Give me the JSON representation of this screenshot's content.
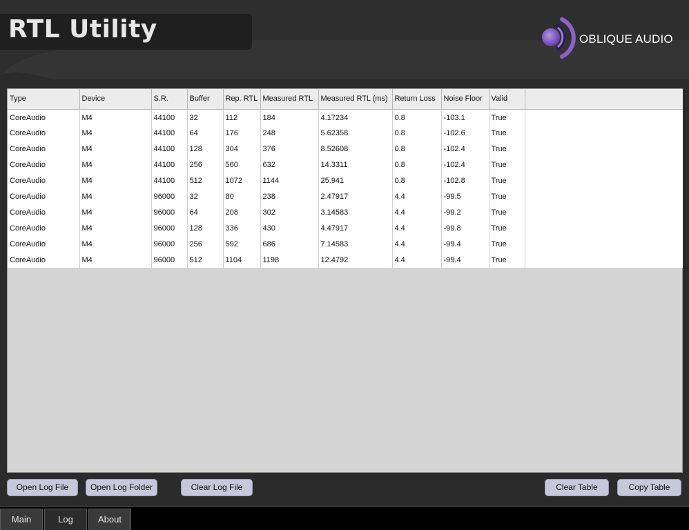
{
  "header": {
    "title": "RTL Utility",
    "brand": "OBLIQUE AUDIO",
    "logo_icon": "oblique-audio-logo-icon",
    "accent_color": "#8a62c8"
  },
  "table": {
    "columns": [
      "Type",
      "Device",
      "S.R.",
      "Buffer",
      "Rep. RTL",
      "Measured RTL",
      "Measured RTL (ms)",
      "Return Loss",
      "Noise Floor",
      "Valid"
    ],
    "rows": [
      [
        "CoreAudio",
        "M4",
        "44100",
        "32",
        "112",
        "184",
        "4.17234",
        "0.8",
        "-103.1",
        "True"
      ],
      [
        "CoreAudio",
        "M4",
        "44100",
        "64",
        "176",
        "248",
        "5.62358",
        "0.8",
        "-102.6",
        "True"
      ],
      [
        "CoreAudio",
        "M4",
        "44100",
        "128",
        "304",
        "376",
        "8.52608",
        "0.8",
        "-102.4",
        "True"
      ],
      [
        "CoreAudio",
        "M4",
        "44100",
        "256",
        "560",
        "632",
        "14.3311",
        "0.8",
        "-102.4",
        "True"
      ],
      [
        "CoreAudio",
        "M4",
        "44100",
        "512",
        "1072",
        "1144",
        "25.941",
        "0.8",
        "-102.8",
        "True"
      ],
      [
        "CoreAudio",
        "M4",
        "96000",
        "32",
        "80",
        "238",
        "2.47917",
        "4.4",
        "-99.5",
        "True"
      ],
      [
        "CoreAudio",
        "M4",
        "96000",
        "64",
        "208",
        "302",
        "3.14583",
        "4.4",
        "-99.2",
        "True"
      ],
      [
        "CoreAudio",
        "M4",
        "96000",
        "128",
        "336",
        "430",
        "4.47917",
        "4.4",
        "-99.8",
        "True"
      ],
      [
        "CoreAudio",
        "M4",
        "96000",
        "256",
        "592",
        "686",
        "7.14583",
        "4.4",
        "-99.4",
        "True"
      ],
      [
        "CoreAudio",
        "M4",
        "96000",
        "512",
        "1104",
        "1198",
        "12.4792",
        "4.4",
        "-99.4",
        "True"
      ]
    ]
  },
  "buttons": {
    "open_log_file": "Open Log File",
    "open_log_folder": "Open Log Folder",
    "clear_log_file": "Clear Log File",
    "clear_table": "Clear Table",
    "copy_table": "Copy Table"
  },
  "tabs": [
    {
      "label": "Main",
      "active": false
    },
    {
      "label": "Log",
      "active": true
    },
    {
      "label": "About",
      "active": false
    }
  ]
}
